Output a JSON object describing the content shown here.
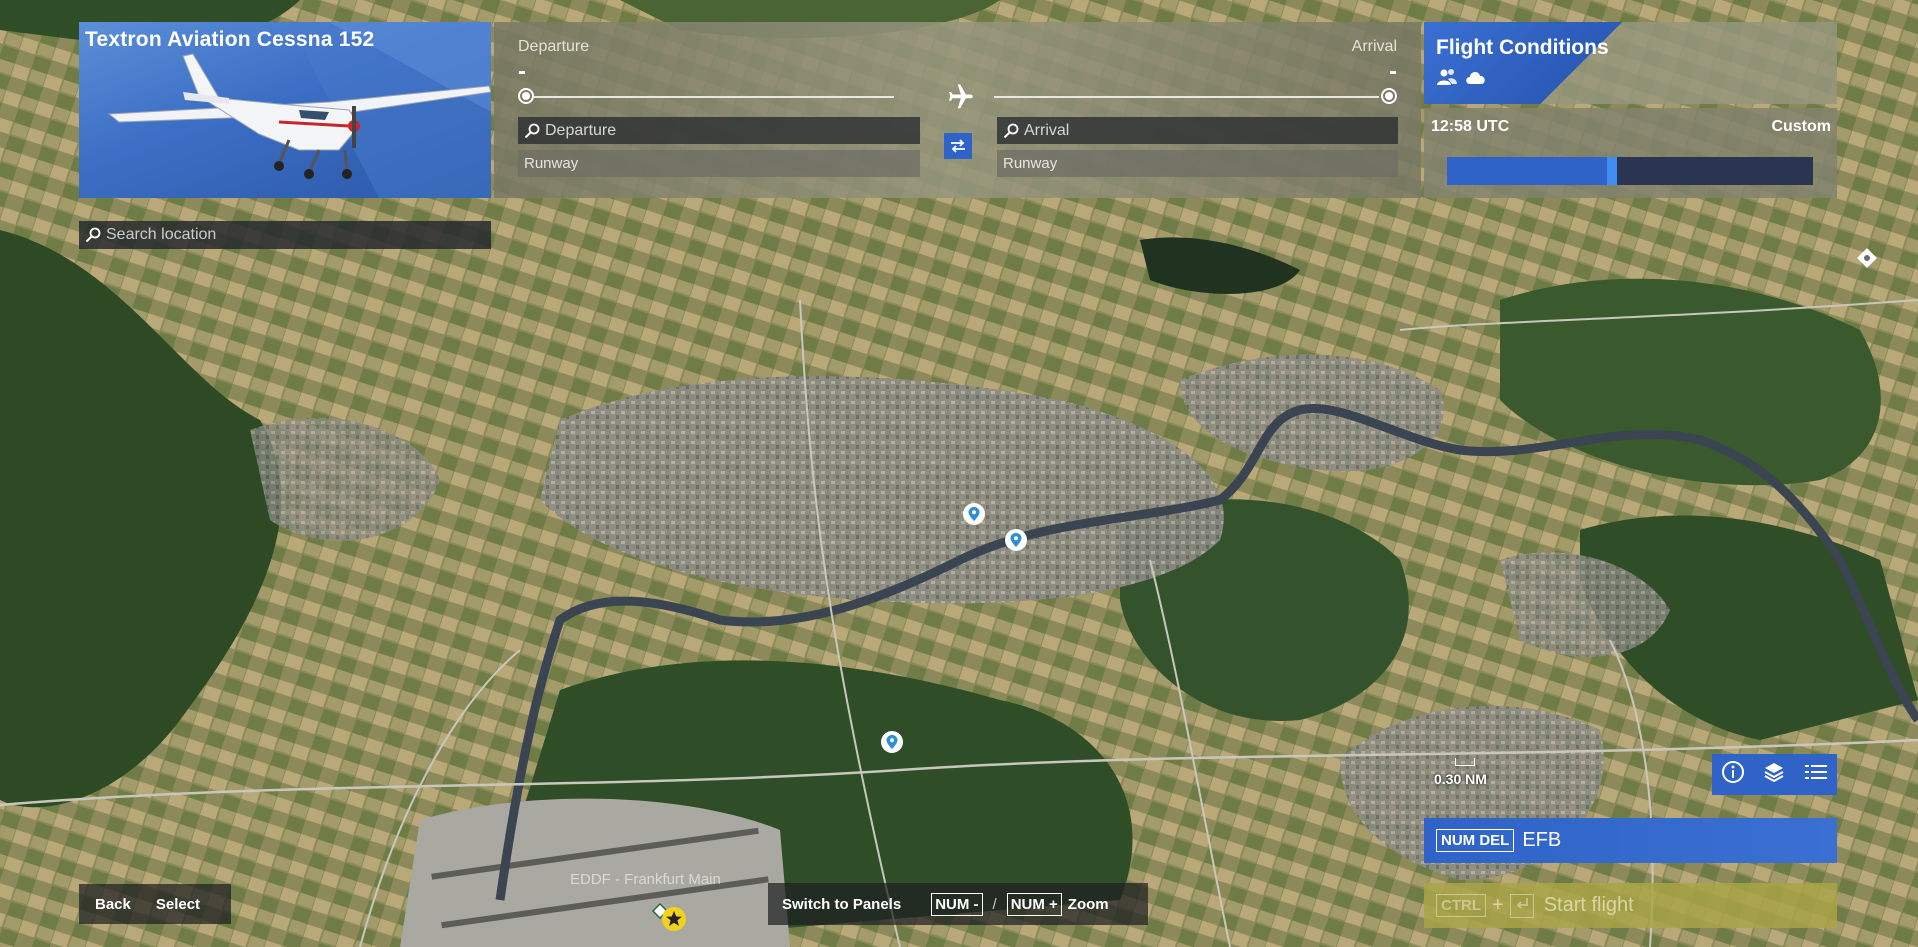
{
  "aircraft": {
    "name": "Textron Aviation Cessna 152"
  },
  "search": {
    "placeholder": "Search location"
  },
  "route": {
    "departure_label": "Departure",
    "arrival_label": "Arrival",
    "departure_value": "-",
    "arrival_value": "-",
    "departure_placeholder": "Departure",
    "arrival_placeholder": "Arrival",
    "departure_runway": "Runway",
    "arrival_runway": "Runway"
  },
  "conditions": {
    "title": "Flight Conditions",
    "time": "12:58 UTC",
    "preset": "Custom",
    "time_of_day_fraction": 0.45
  },
  "map": {
    "scale_label": "0.30 NM",
    "airport_label": "EDDF - Frankfurt Main",
    "icons": [
      "location-pin-icon",
      "airport-icon",
      "star-icon",
      "compass-icon"
    ]
  },
  "map_tools": [
    "info-icon",
    "layers-icon",
    "legend-icon"
  ],
  "efb": {
    "key": "NUM DEL",
    "label": "EFB"
  },
  "start_flight": {
    "key": "CTRL",
    "plus": "+",
    "label": "Start flight"
  },
  "hints": {
    "back": "Back",
    "select": "Select",
    "switch_panels": "Switch to Panels",
    "num_minus": "NUM -",
    "slash": "/",
    "num_plus": "NUM +",
    "zoom": "Zoom"
  },
  "colors": {
    "accent_blue": "#2f63c7",
    "start_flight_yellow": "#aaa546"
  }
}
